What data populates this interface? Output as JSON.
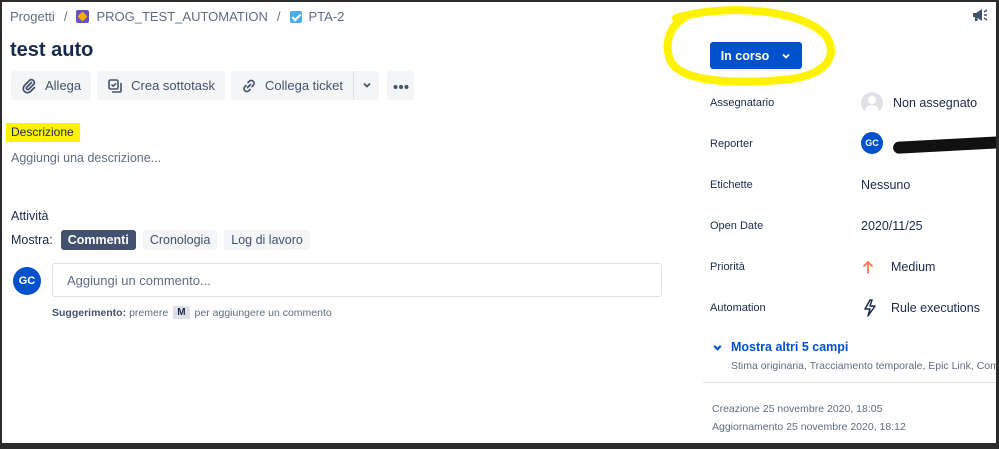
{
  "breadcrumb": {
    "root": "Progetti",
    "project": "PROG_TEST_AUTOMATION",
    "issue_key": "PTA-2"
  },
  "issue": {
    "title": "test auto"
  },
  "toolbar": {
    "attach": "Allega",
    "create_subtask": "Crea sottotask",
    "link_issue": "Collega ticket"
  },
  "description": {
    "label": "Descrizione",
    "placeholder": "Aggiungi una descrizione..."
  },
  "activity": {
    "title": "Attività",
    "show_label": "Mostra:",
    "tabs": [
      "Commenti",
      "Cronologia",
      "Log di lavoro"
    ],
    "active_tab": "Commenti",
    "user_initials": "GC",
    "comment_placeholder": "Aggiungi un commento...",
    "tip_bold": "Suggerimento:",
    "tip_pre": "premere",
    "tip_key": "M",
    "tip_post": "per aggiungere un commento"
  },
  "status": {
    "label": "In corso",
    "color": "#0052cc",
    "highlight_color": "#fff200"
  },
  "fields": {
    "assignee": {
      "label": "Assegnatario",
      "value": "Non assegnato"
    },
    "reporter": {
      "label": "Reporter",
      "initials": "GC"
    },
    "labels": {
      "label": "Etichette",
      "value": "Nessuno"
    },
    "open_date": {
      "label": "Open Date",
      "value": "2020/11/25"
    },
    "priority": {
      "label": "Priorità",
      "value": "Medium",
      "icon": "arrow-up-icon",
      "color": "#ff7452"
    },
    "automation": {
      "label": "Automation",
      "value": "Rule executions",
      "icon": "lightning-icon"
    }
  },
  "more_fields": {
    "label": "Mostra altri 5 campi",
    "sub": "Stima originaria, Tracciamento temporale, Epic Link, Compo"
  },
  "meta": {
    "created": "Creazione 25 novembre 2020, 18:05",
    "updated": "Aggiornamento 25 novembre 2020, 18:12"
  }
}
